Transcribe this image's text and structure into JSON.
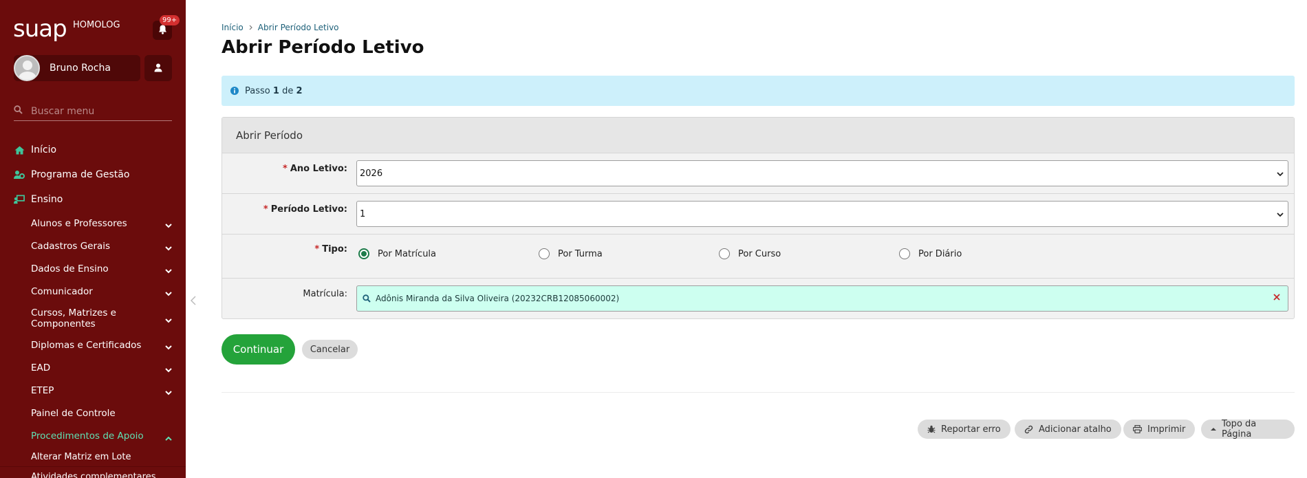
{
  "app": {
    "logo": "suap",
    "environment": "HOMOLOG",
    "notifications_badge": "99+"
  },
  "user": {
    "name": "Bruno Rocha"
  },
  "search": {
    "placeholder": "Buscar menu"
  },
  "menu": {
    "top": [
      {
        "label": "Início",
        "icon": "home-icon"
      },
      {
        "label": "Programa de Gestão",
        "icon": "users-cog-icon"
      },
      {
        "label": "Ensino",
        "icon": "chalkboard-icon"
      }
    ],
    "ensino_items": [
      "Alunos e Professores",
      "Cadastros Gerais",
      "Dados de Ensino",
      "Comunicador",
      "Cursos, Matrizes e Componentes",
      "Diplomas e Certificados",
      "EAD",
      "ETEP",
      "Painel de Controle",
      "Procedimentos de Apoio"
    ],
    "procedimentos_items": [
      "Alterar Matriz em Lote",
      "Atividades complementares"
    ]
  },
  "breadcrumb": {
    "home": "Início",
    "current": "Abrir Período Letivo"
  },
  "page": {
    "title": "Abrir Período Letivo"
  },
  "alert": {
    "prefix": "Passo",
    "step": "1",
    "middle": "de",
    "total": "2"
  },
  "form": {
    "section_title": "Abrir Período",
    "ano_letivo": {
      "label": "Ano Letivo:",
      "value": "2026"
    },
    "periodo_letivo": {
      "label": "Período Letivo:",
      "value": "1"
    },
    "tipo": {
      "label": "Tipo:",
      "options": [
        "Por Matrícula",
        "Por Turma",
        "Por Curso",
        "Por Diário"
      ],
      "selected": "Por Matrícula"
    },
    "matricula": {
      "label": "Matrícula:",
      "value": "Adônis Miranda da Silva Oliveira (20232CRB12085060002)"
    }
  },
  "buttons": {
    "continue": "Continuar",
    "cancel": "Cancelar"
  },
  "footer": {
    "report": "Reportar erro",
    "shortcut": "Adicionar atalho",
    "print": "Imprimir",
    "top": "Topo da Página"
  },
  "colors": {
    "sidebar": "#6b0c0c",
    "primary": "#24a33a",
    "active_menu": "#5fe0b3",
    "alert_bg": "#cdf0fb",
    "autocomplete_bg": "#cdfff0"
  }
}
